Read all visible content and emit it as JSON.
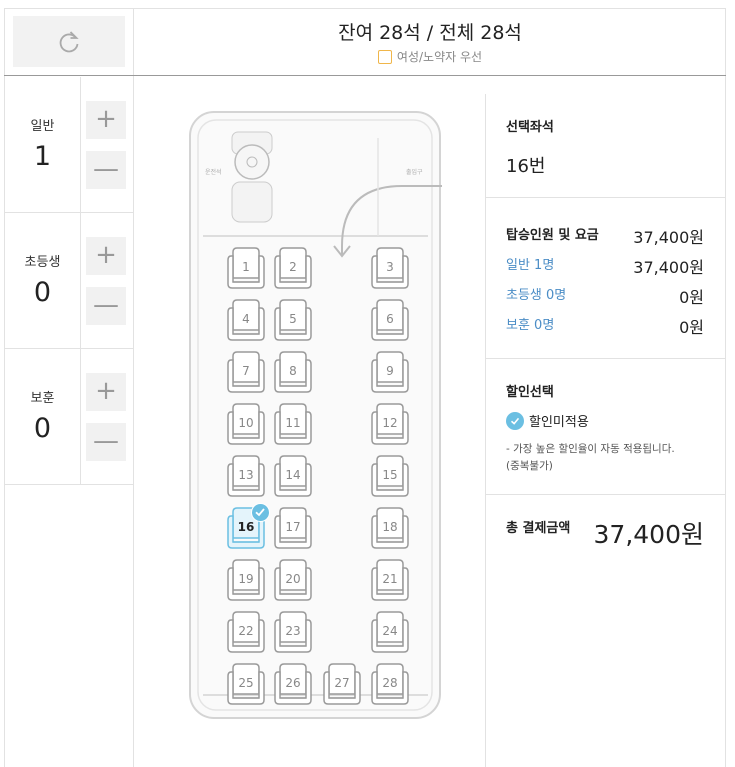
{
  "header": {
    "seat_count": "잔여 28석 / 전체 28석",
    "priority_label": "여성/노약자 우선",
    "refresh_icon": "refresh-icon"
  },
  "passengers": [
    {
      "label": "일반",
      "count": "1"
    },
    {
      "label": "초등생",
      "count": "0"
    },
    {
      "label": "보훈",
      "count": "0"
    }
  ],
  "buttons": {
    "plus": "+",
    "minus": "—"
  },
  "bus": {
    "driver_label": "운전석",
    "entrance_label": "출입구",
    "seats": [
      {
        "n": "1",
        "selected": false
      },
      {
        "n": "2",
        "selected": false
      },
      {
        "n": "3",
        "selected": false
      },
      {
        "n": "4",
        "selected": false
      },
      {
        "n": "5",
        "selected": false
      },
      {
        "n": "6",
        "selected": false
      },
      {
        "n": "7",
        "selected": false
      },
      {
        "n": "8",
        "selected": false
      },
      {
        "n": "9",
        "selected": false
      },
      {
        "n": "10",
        "selected": false
      },
      {
        "n": "11",
        "selected": false
      },
      {
        "n": "12",
        "selected": false
      },
      {
        "n": "13",
        "selected": false
      },
      {
        "n": "14",
        "selected": false
      },
      {
        "n": "15",
        "selected": false
      },
      {
        "n": "16",
        "selected": true
      },
      {
        "n": "17",
        "selected": false
      },
      {
        "n": "18",
        "selected": false
      },
      {
        "n": "19",
        "selected": false
      },
      {
        "n": "20",
        "selected": false
      },
      {
        "n": "21",
        "selected": false
      },
      {
        "n": "22",
        "selected": false
      },
      {
        "n": "23",
        "selected": false
      },
      {
        "n": "24",
        "selected": false
      },
      {
        "n": "25",
        "selected": false
      },
      {
        "n": "26",
        "selected": false
      },
      {
        "n": "27",
        "selected": false
      },
      {
        "n": "28",
        "selected": false
      }
    ]
  },
  "selection": {
    "title": "선택좌석",
    "seat": "16번"
  },
  "fare": {
    "title": "탑승인원 및 요금",
    "total": "37,400원",
    "rows": [
      {
        "label": "일반 1명",
        "amount": "37,400원"
      },
      {
        "label": "초등생 0명",
        "amount": "0원"
      },
      {
        "label": "보훈 0명",
        "amount": "0원"
      }
    ]
  },
  "discount": {
    "title": "할인선택",
    "option": "할인미적용",
    "note": "- 가장 높은 할인율이 자동 적용됩니다.",
    "note2": "(중복불가)"
  },
  "payment": {
    "title": "총 결제금액",
    "amount": "37,400원"
  },
  "colors": {
    "accent": "#6bbfe2",
    "link": "#4b8dc6",
    "priority": "#f0b64a"
  }
}
